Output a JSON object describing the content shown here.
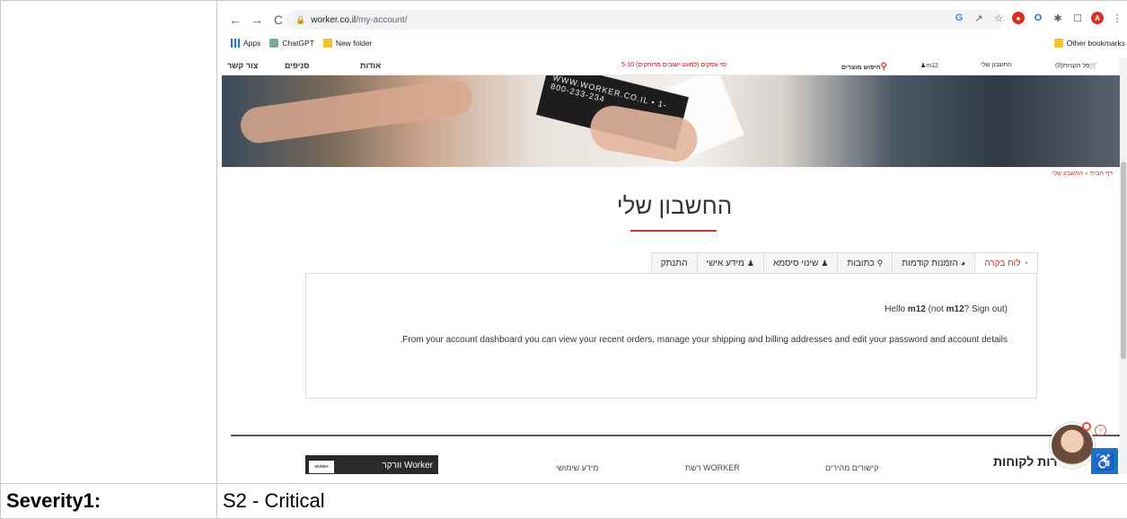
{
  "browser": {
    "url_host": "worker.co.il",
    "url_path": "/my-account/",
    "nav": {
      "back": "←",
      "forward": "→",
      "reload": "C"
    },
    "extensions": [
      "G",
      "share",
      "☆",
      "ext",
      "O",
      "✱",
      "☐",
      "A",
      "⋮"
    ]
  },
  "bookmarks": {
    "apps": "Apps",
    "chatgpt": "ChatGPT",
    "new_folder": "New folder",
    "other": "Other bookmarks"
  },
  "site_nav": {
    "contact": "צור קשר",
    "branches": "סניפים",
    "about": "אודות",
    "promo": "5-10 ימי עסקים (למעט ישובים מרוחקים)",
    "search": "חיפוש מוצרים",
    "user": "m12",
    "my_account": "החשבון שלי",
    "cart": "סל הקניות(0)"
  },
  "hero": {
    "card_text": "WWW.WORKER.CO.IL • 1-800-233-234"
  },
  "breadcrumb": "דף הבית » החשבון שלי",
  "page_title": "החשבון שלי",
  "tabs": [
    {
      "label": "לוח בקרה",
      "icon": "dashboard-icon",
      "glyph": "◔"
    },
    {
      "label": "הזמנות קודמות",
      "icon": "pie-chart-icon",
      "glyph": "◕"
    },
    {
      "label": "כתובות",
      "icon": "map-pin-icon",
      "glyph": "⚲"
    },
    {
      "label": "שינוי סיסמא",
      "icon": "user-icon",
      "glyph": "♟"
    },
    {
      "label": "מידע אישי",
      "icon": "user-icon",
      "glyph": "♟"
    },
    {
      "label": "התנתק",
      "icon": "",
      "glyph": ""
    }
  ],
  "panel": {
    "hello_prefix": "Hello ",
    "hello_user": "m12",
    "hello_mid": " (not ",
    "hello_user2": "m12",
    "hello_suffix": "? Sign out)",
    "dashboard_text": ".From your account dashboard you can view your recent orders, manage your shipping and billing addresses and edit your password and account details"
  },
  "footer": {
    "title": "שירות לקוחות",
    "col1": "קישורים מהירים",
    "col2": "רשת WORKER",
    "col3": "מידע שימושי",
    "image_text": "וורקר Worker",
    "logo_text": "worker"
  },
  "widgets": {
    "up": "↑",
    "accessibility": "♿"
  },
  "severity": {
    "label": "Severity1:",
    "value": "S2 - Critical"
  },
  "colors": {
    "accent": "#c0392b",
    "a11y": "#1e73be"
  }
}
